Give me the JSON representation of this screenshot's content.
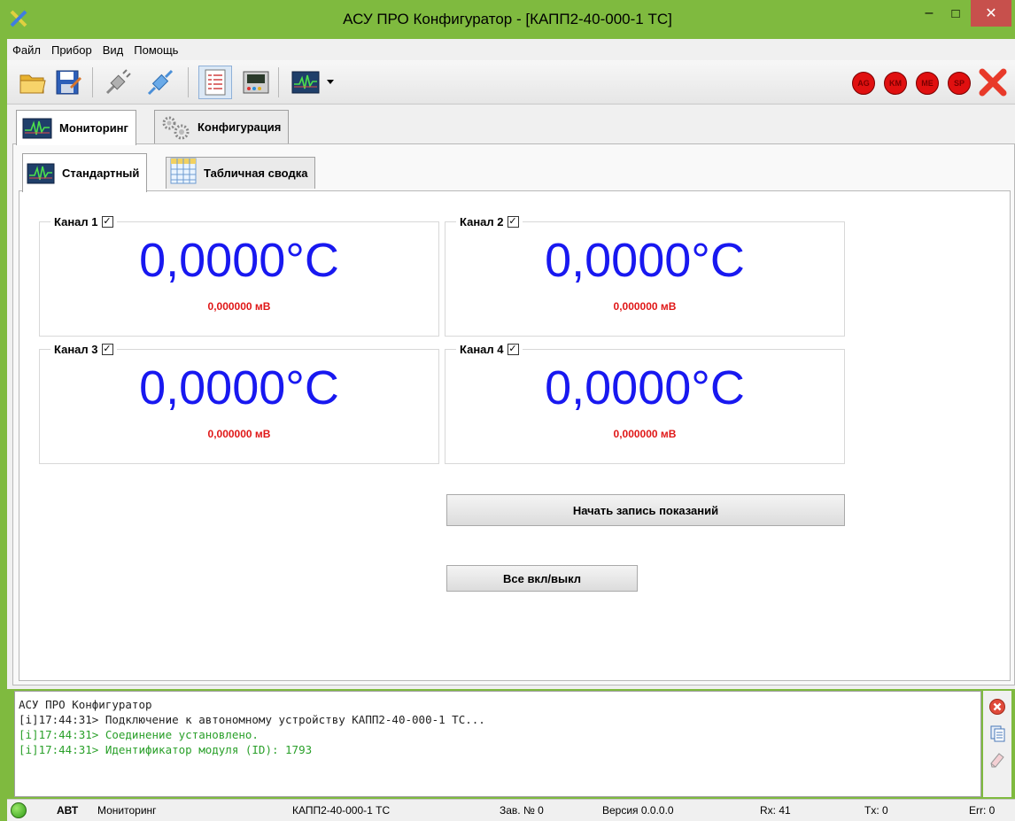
{
  "window": {
    "title": "АСУ ПРО Конфигуратор - [КАПП2-40-000-1 ТС]",
    "min_glyph": "–",
    "max_glyph": "□",
    "close_glyph": "✕"
  },
  "menu": {
    "items": [
      "Файл",
      "Прибор",
      "Вид",
      "Помощь"
    ]
  },
  "toolbar": {
    "icons": [
      "open-folder-icon",
      "save-icon",
      "disconnect-plug-icon",
      "connect-plug-icon",
      "report-list-icon",
      "device-panel-icon",
      "monitor-graph-icon",
      "dropdown-arrow-icon"
    ],
    "leds": [
      "AG",
      "KM",
      "ME",
      "SP"
    ],
    "close_icon": "red-x-icon",
    "colors": {
      "led": "#e01010",
      "close": "#e83a2a"
    }
  },
  "outer_tabs": [
    {
      "label": "Мониторинг",
      "icon": "monitor-graph-icon",
      "active": true
    },
    {
      "label": "Конфигурация",
      "icon": "gears-icon",
      "active": false
    }
  ],
  "inner_tabs": [
    {
      "label": "Стандартный",
      "icon": "monitor-graph-icon",
      "active": true
    },
    {
      "label": "Табличная сводка",
      "icon": "table-icon",
      "active": false
    }
  ],
  "channels": [
    {
      "label": "Канал 1",
      "checked": "✓",
      "temperature": "0,0000°C",
      "voltage": "0,000000 мВ"
    },
    {
      "label": "Канал 2",
      "checked": "✓",
      "temperature": "0,0000°C",
      "voltage": "0,000000 мВ"
    },
    {
      "label": "Канал 3",
      "checked": "✓",
      "temperature": "0,0000°C",
      "voltage": "0,000000 мВ"
    },
    {
      "label": "Канал 4",
      "checked": "✓",
      "temperature": "0,0000°C",
      "voltage": "0,000000 мВ"
    }
  ],
  "buttons": {
    "start_record": "Начать запись показаний",
    "toggle_all": "Все вкл/выкл"
  },
  "log": {
    "lines": [
      {
        "text": "АСУ ПРО Конфигуратор",
        "kind": "neutral"
      },
      {
        "text": "[i]17:44:31> Подключение к автономному устройству КАПП2-40-000-1 ТС...",
        "kind": "neutral"
      },
      {
        "text": "[i]17:44:31> Соединение установлено.",
        "kind": "info"
      },
      {
        "text": "[i]17:44:31> Идентификатор модуля (ID): 1793",
        "kind": "info"
      }
    ],
    "tools": [
      "clear-log-icon",
      "copy-log-icon",
      "eraser-icon"
    ],
    "colors": {
      "info": "#2aa02a",
      "neutral": "#222222"
    }
  },
  "status": {
    "mode": "АВТ",
    "view": "Мониторинг",
    "device": "КАПП2-40-000-1 ТС",
    "serial": "Зав. № 0",
    "version": "Версия 0.0.0.0",
    "rx": "Rx: 41",
    "tx": "Tx: 0",
    "err": "Err: 0"
  }
}
